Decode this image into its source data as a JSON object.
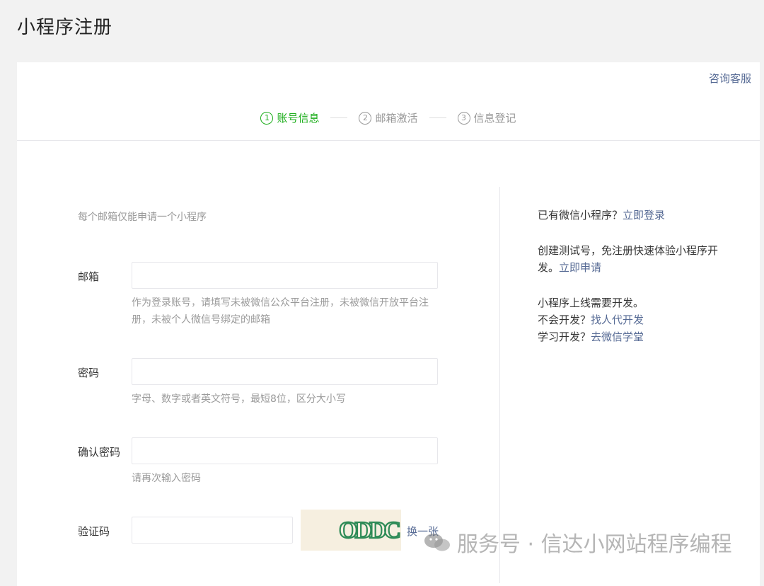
{
  "page": {
    "title": "小程序注册"
  },
  "header": {
    "consult_label": "咨询客服"
  },
  "steps": [
    {
      "num": "1",
      "label": "账号信息",
      "active": true
    },
    {
      "num": "2",
      "label": "邮箱激活",
      "active": false
    },
    {
      "num": "3",
      "label": "信息登记",
      "active": false
    }
  ],
  "form": {
    "tip": "每个邮箱仅能申请一个小程序",
    "email": {
      "label": "邮箱",
      "value": "",
      "hint": "作为登录账号，请填写未被微信公众平台注册，未被微信开放平台注册，未被个人微信号绑定的邮箱"
    },
    "password": {
      "label": "密码",
      "value": "",
      "hint": "字母、数字或者英文符号，最短8位，区分大小写"
    },
    "confirm_password": {
      "label": "确认密码",
      "value": "",
      "hint": "请再次输入密码"
    },
    "captcha": {
      "label": "验证码",
      "value": "",
      "image_text": "ODDC",
      "refresh_label": "换一张"
    }
  },
  "side": {
    "login_text": "已有微信小程序？",
    "login_link": "立即登录",
    "test_text": "创建测试号，免注册快速体验小程序开发。",
    "test_link": "立即申请",
    "dev_line1": "小程序上线需要开发。",
    "dev_line2_text": "不会开发？",
    "dev_line2_link": "找人代开发",
    "dev_line3_text": "学习开发？",
    "dev_line3_link": "去微信学堂"
  },
  "watermark": {
    "text": "服务号 · 信达小网站程序编程"
  },
  "colors": {
    "accent_green": "#1aad19",
    "link_blue": "#576b95",
    "muted": "#999999"
  }
}
